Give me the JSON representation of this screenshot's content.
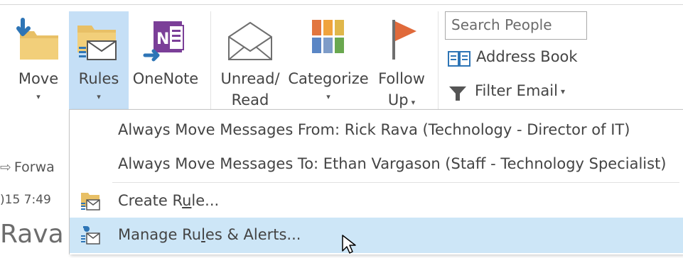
{
  "ribbon": {
    "move": {
      "label": "Move",
      "arrow": "▾",
      "icon": "move-folder-icon"
    },
    "rules": {
      "label": "Rules",
      "arrow": "▾",
      "icon": "rules-icon",
      "active": true
    },
    "onenote": {
      "label": "OneNote",
      "icon": "onenote-icon"
    },
    "unread": {
      "label_line1": "Unread/",
      "label_line2": "Read",
      "icon": "envelope-icon"
    },
    "categorize": {
      "label": "Categorize",
      "arrow": "▾",
      "icon": "categorize-icon"
    },
    "followup": {
      "label_line1": "Follow",
      "label_line2": "Up",
      "arrow": "▾",
      "icon": "flag-icon"
    }
  },
  "find": {
    "search_placeholder": "Search People",
    "address_book": "Address Book",
    "filter_email": "Filter Email",
    "filter_arrow": "▾"
  },
  "background": {
    "forward": "Forwa",
    "date": ")15 7:49",
    "name": "Rava"
  },
  "rules_menu": {
    "items": [
      {
        "label": "Always Move Messages From: Rick Rava (Technology - Director of IT)"
      },
      {
        "label": "Always Move Messages To: Ethan Vargason (Staff - Technology Specialist)"
      },
      {
        "label_pre": "Create R",
        "label_ul": "u",
        "label_post": "le...",
        "icon": "create-rule-icon"
      },
      {
        "label_pre": "Manage Ru",
        "label_ul": "l",
        "label_post": "es & Alerts...",
        "icon": "manage-rules-icon",
        "highlighted": true
      }
    ]
  },
  "colors": {
    "active_button": "#c5dff6",
    "menu_highlight": "#cde6f7",
    "folder_yellow": "#e8c066",
    "onenote_purple": "#7b3f98",
    "flag_orange": "#e06a3b",
    "arrow_blue": "#2e75b6"
  }
}
